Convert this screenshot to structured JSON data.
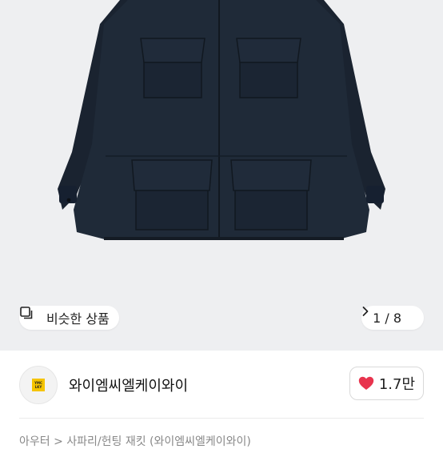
{
  "hero": {
    "image_alt": "navy field jacket product photo",
    "similar_button": {
      "icon": "similar-square-icon",
      "label": "비슷한 상품"
    },
    "counter": {
      "current": "1",
      "total": "8",
      "text": "1 / 8",
      "icon": "chevron-right-icon"
    }
  },
  "seller": {
    "name": "와이엠씨엘케이와이",
    "avatar_logo_lines": [
      "YMC",
      "LKY"
    ],
    "likes": {
      "icon": "heart-icon",
      "count": "1.7만",
      "color": "#e8344e"
    }
  },
  "breadcrumb": {
    "text": "아우터 > 사파리/헌팅 재킷 (와이엠씨엘케이와이)"
  }
}
